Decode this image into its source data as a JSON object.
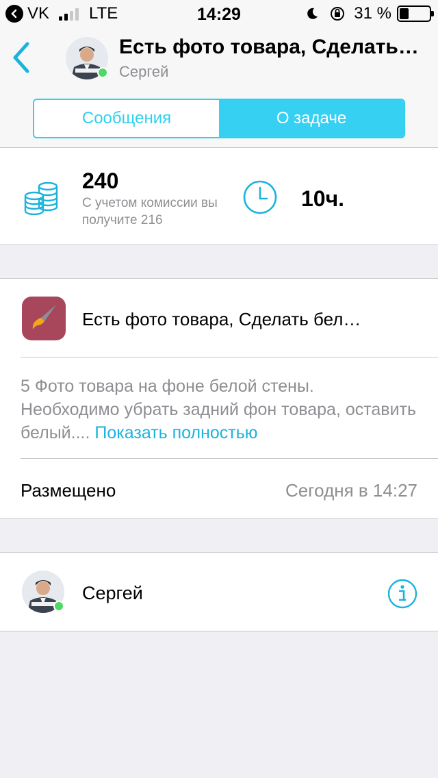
{
  "status_bar": {
    "carrier": "VK",
    "network": "LTE",
    "time": "14:29",
    "battery_percent": "31 %",
    "battery_level": 0.31
  },
  "header": {
    "title": "Есть фото товара, Сделать…",
    "author": "Сергей",
    "online": true
  },
  "tabs": [
    {
      "label": "Сообщения",
      "active": false
    },
    {
      "label": "О задаче",
      "active": true
    }
  ],
  "stats": {
    "price": "240",
    "commission_text": "С учетом комиссии вы получите 216",
    "duration": "10ч."
  },
  "task": {
    "category_icon": "paintbrush-icon",
    "name": "Есть фото товара, Сделать бел…",
    "description": "5 Фото товара на фоне белой стены. Необходимо убрать задний фон товара, оставить белый....",
    "show_more_label": "Показать полностью",
    "placed_label": "Размещено",
    "placed_value": "Сегодня в 14:27"
  },
  "author": {
    "name": "Сергей",
    "online": true,
    "info_icon": "info-icon"
  },
  "colors": {
    "accent": "#35d0f2",
    "link": "#1ab3dd",
    "category_bg": "#a8465b",
    "online": "#4cd964",
    "secondary_text": "#8e8e93",
    "background": "#efeff4"
  }
}
